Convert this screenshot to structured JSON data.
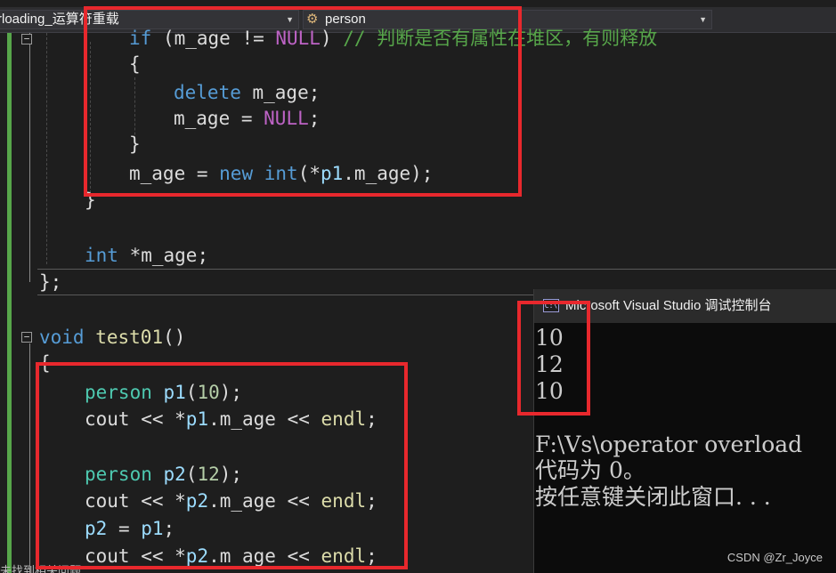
{
  "navbar": {
    "file_dropdown": "rloading_运算符重载",
    "class_dropdown": "person"
  },
  "code": {
    "if_line": {
      "kw": "if",
      "text": " (m_age != ",
      "null": "NULL",
      "close": ")",
      "comment": " // 判断是否有属性在堆区，有则释放"
    },
    "open_brace": "{",
    "delete_line": {
      "kw": "delete",
      "text": " m_age;"
    },
    "assign_null_line": {
      "text": "m_age = ",
      "null": "NULL",
      "end": ";"
    },
    "close_brace": "}",
    "new_line": {
      "text": "m_age = ",
      "kw_new": "new",
      "kw_int": "int",
      "rest_a": "(*",
      "p1": "p1",
      "rest_b": ".m_age);"
    },
    "func_close_brace": "}",
    "member_decl": {
      "kw": "int",
      "text": " *m_age;"
    },
    "class_end": "};",
    "test_sig": {
      "kw": "void",
      "name": "test01",
      "paren": "()"
    },
    "test_open": "{",
    "p1_decl": {
      "type": "person",
      "var": "p1",
      "num": "10",
      "open": "(",
      "close": ");"
    },
    "cout1": {
      "cout": "cout",
      "op": " << *",
      "var": "p1",
      "mem": ".m_age << ",
      "endl": "endl",
      "end": ";"
    },
    "p2_decl": {
      "type": "person",
      "var": "p2",
      "num": "12",
      "open": "(",
      "close": ");"
    },
    "cout2": {
      "cout": "cout",
      "op": " << *",
      "var": "p2",
      "mem": ".m_age << ",
      "endl": "endl",
      "end": ";"
    },
    "assign": {
      "left": "p2",
      "op": " = ",
      "right": "p1",
      "end": ";"
    },
    "cout3": {
      "cout": "cout",
      "op": " << *",
      "var": "p2",
      "mem": ".m_age << ",
      "endl": "endl",
      "end": ";"
    }
  },
  "console": {
    "title": "Microsoft Visual Studio 调试控制台",
    "icon_label": "C:\\",
    "output": [
      "10",
      "12",
      "10"
    ],
    "path_line": "F:\\Vs\\operator overload",
    "exit_line": "代码为 0。",
    "press_key_line": "按任意键关闭此窗口. . ."
  },
  "watermark": "CSDN @Zr_Joyce",
  "status_fragment": "未找到相关问题",
  "colors": {
    "highlight_box": "#e8282d",
    "keyword": "#569cd6",
    "type": "#4ec9b0",
    "function": "#dcdcaa",
    "member": "#9cdcfe",
    "number": "#b5cea8",
    "comment": "#57a64a",
    "macro": "#bd63c5"
  },
  "icons": [
    "chevron-down-icon",
    "class-icon",
    "fold-icon",
    "console-app-icon"
  ]
}
